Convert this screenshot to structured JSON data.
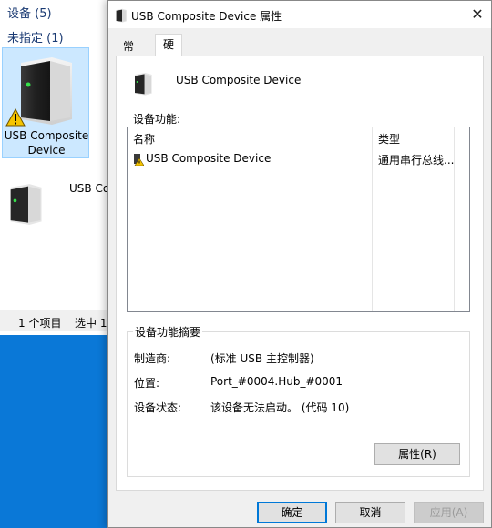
{
  "explorer": {
    "group_devices": "设备 (5)",
    "group_unspecified": "未指定 (1)",
    "tile_label": "USB Composite Device",
    "list_label": "USB Co",
    "status_count": "1 个项目",
    "status_selected": "选中 1"
  },
  "dialog": {
    "title": "USB Composite Device 属性",
    "close_glyph": "✕",
    "tabs": [
      {
        "label": "常规",
        "active": false
      },
      {
        "label": "硬件",
        "active": true
      }
    ],
    "device_name": "USB Composite Device",
    "functions_label": "设备功能:",
    "columns": {
      "name": "名称",
      "type": "类型"
    },
    "rows": [
      {
        "name": "USB Composite Device",
        "type": "通用串行总线..."
      }
    ],
    "summary": {
      "legend": "设备功能摘要",
      "manufacturer_key": "制造商:",
      "manufacturer_val": "(标准 USB 主控制器)",
      "location_key": "位置:",
      "location_val": "Port_#0004.Hub_#0001",
      "status_key": "设备状态:",
      "status_val": "该设备无法启动。 (代码 10)"
    },
    "properties_button": "属性(R)",
    "ok_button": "确定",
    "cancel_button": "取消",
    "apply_button": "应用(A)"
  },
  "colors": {
    "accent": "#0078d7",
    "desktop": "#0a78d7",
    "selection": "#cce8ff",
    "warning": "#f5c400"
  },
  "icons": [
    "device-icon",
    "warning-icon",
    "close-icon"
  ]
}
